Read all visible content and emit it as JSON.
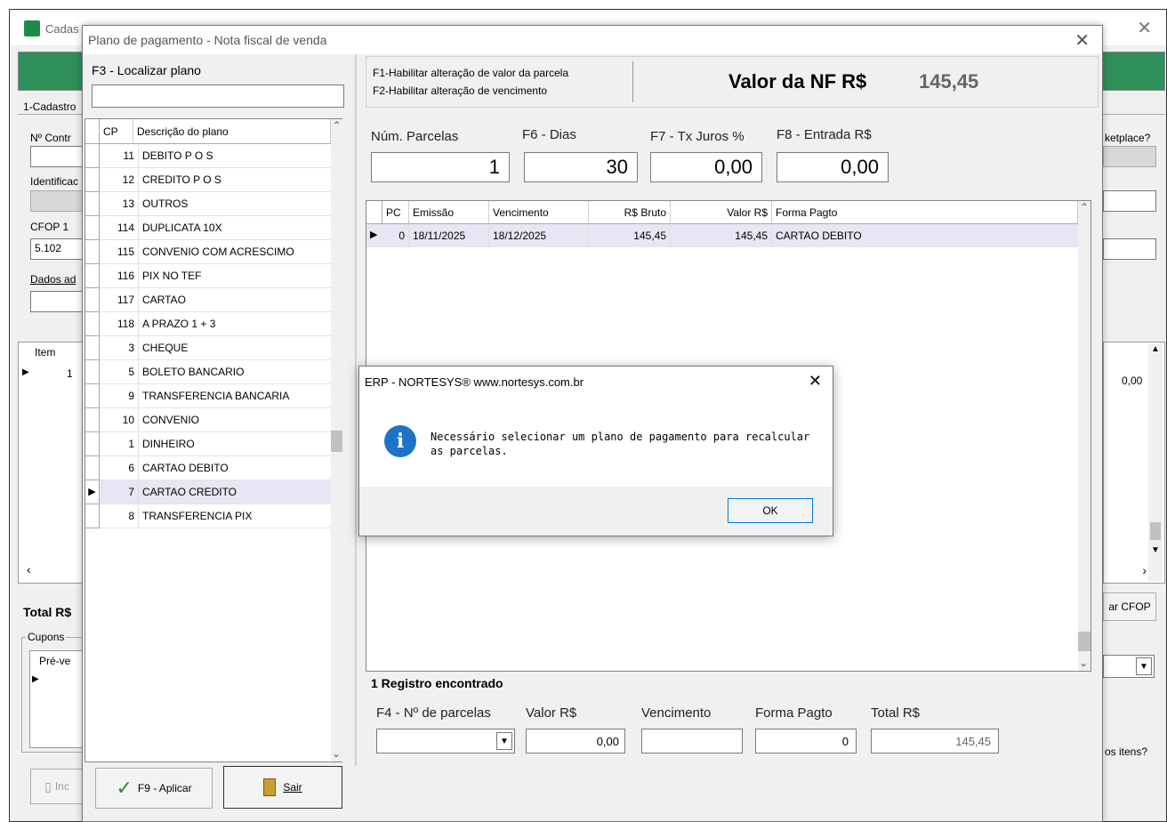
{
  "back_window": {
    "title_fragment": "Cadas",
    "tab_label": "1-Cadastro",
    "labels": {
      "controle": "Nº Contr",
      "identificacao": "Identificac",
      "cfop": "CFOP 1",
      "dados_ad": "Dados ad",
      "marketplace": "ketplace?",
      "total": "Total R$",
      "cupons": "Cupons",
      "pre_venda": "Pré-ve",
      "item_col": "Item",
      "item_val": "1",
      "right_value": "0,00",
      "itens_q": "os itens?",
      "inc_btn": "Inc",
      "cfop_btn": "ar CFOP"
    },
    "cfop_value": "5.102"
  },
  "dialog": {
    "title": "Plano de pagamento - Nota fiscal de venda",
    "search_label": "F3 - Localizar plano",
    "plan_headers": {
      "cp": "CP",
      "desc": "Descrição do plano"
    },
    "plans": [
      {
        "cp": "11",
        "desc": "DEBITO P O S"
      },
      {
        "cp": "12",
        "desc": "CREDITO P O S"
      },
      {
        "cp": "13",
        "desc": "OUTROS"
      },
      {
        "cp": "114",
        "desc": "DUPLICATA 10X"
      },
      {
        "cp": "115",
        "desc": "CONVENIO COM ACRESCIMO"
      },
      {
        "cp": "116",
        "desc": "PIX NO TEF"
      },
      {
        "cp": "117",
        "desc": "CARTAO"
      },
      {
        "cp": "118",
        "desc": "A PRAZO 1 + 3"
      },
      {
        "cp": "3",
        "desc": "CHEQUE"
      },
      {
        "cp": "5",
        "desc": "BOLETO BANCARIO"
      },
      {
        "cp": "9",
        "desc": "TRANSFERENCIA BANCARIA"
      },
      {
        "cp": "10",
        "desc": "CONVENIO"
      },
      {
        "cp": "1",
        "desc": "DINHEIRO"
      },
      {
        "cp": "6",
        "desc": "CARTAO DEBITO"
      },
      {
        "cp": "7",
        "desc": "CARTAO CREDITO"
      },
      {
        "cp": "8",
        "desc": "TRANSFERENCIA PIX"
      }
    ],
    "selected_plan_index": 14,
    "aplicar_label": "F9 - Aplicar",
    "sair_label": "Sair",
    "hint_f1": "F1-Habilitar alteração de valor da parcela",
    "hint_f2": "F2-Habilitar alteração de vencimento",
    "nf_label": "Valor da NF R$",
    "nf_value": "145,45",
    "fields": {
      "parcelas_label": "Núm. Parcelas",
      "parcelas_value": "1",
      "dias_label": "F6 - Dias",
      "dias_value": "30",
      "juros_label": "F7 - Tx Juros %",
      "juros_value": "0,00",
      "entrada_label": "F8 - Entrada R$",
      "entrada_value": "0,00"
    },
    "installments_headers": [
      "PC",
      "Emissão",
      "Vencimento",
      "R$ Bruto",
      "Valor R$",
      "Forma Pagto"
    ],
    "installments": [
      {
        "pc": "0",
        "emissao": "18/11/2025",
        "vencimento": "18/12/2025",
        "bruto": "145,45",
        "valor": "145,45",
        "forma": "CARTAO DEBITO"
      }
    ],
    "records_found": "1 Registro encontrado",
    "bottom": {
      "num_parcelas_label": "F4 - Nº de parcelas",
      "valor_label": "Valor R$",
      "valor_value": "0,00",
      "vencimento_label": "Vencimento",
      "forma_label": "Forma Pagto",
      "forma_value": "0",
      "total_label": "Total R$",
      "total_value": "145,45"
    }
  },
  "message_box": {
    "title": "ERP - NORTESYS® www.nortesys.com.br",
    "text_line1": "Necessário selecionar um plano de pagamento para recalcular",
    "text_line2": "as parcelas.",
    "ok_label": "OK"
  },
  "colors": {
    "banner": "#2f8f5a",
    "selection": "#e6e6f5",
    "info_icon": "#1e73c8"
  }
}
